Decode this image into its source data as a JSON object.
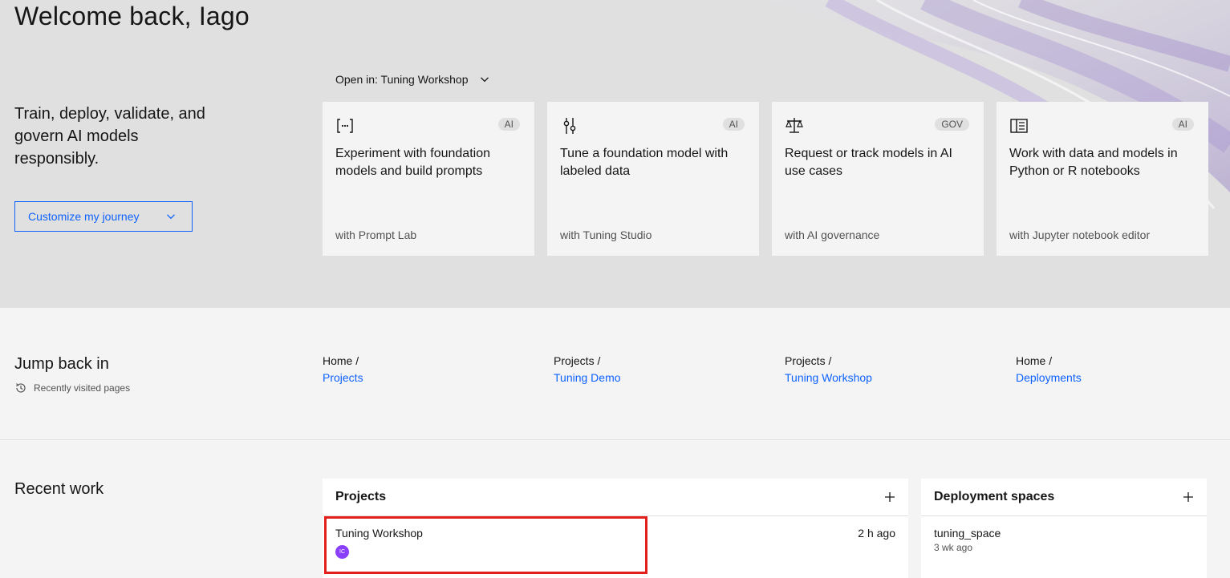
{
  "hero": {
    "welcome": "Welcome back, Iago",
    "tagline": "Train, deploy, validate, and govern AI models responsibly.",
    "customize_label": "Customize my journey",
    "open_in_label": "Open in: Tuning Workshop"
  },
  "cards": [
    {
      "icon": "prompt-brackets-icon",
      "tag": "AI",
      "title": "Experiment with foundation models and build prompts",
      "subtitle": "with Prompt Lab"
    },
    {
      "icon": "tuning-sliders-icon",
      "tag": "AI",
      "title": "Tune a foundation model with labeled data",
      "subtitle": "with Tuning Studio"
    },
    {
      "icon": "scales-icon",
      "tag": "GOV",
      "title": "Request or track models in AI use cases",
      "subtitle": "with AI governance"
    },
    {
      "icon": "notebook-icon",
      "tag": "AI",
      "title": "Work with data and models in Python or R notebooks",
      "subtitle": "with Jupyter notebook editor"
    }
  ],
  "jump": {
    "title": "Jump back in",
    "subtitle": "Recently visited pages",
    "pages": [
      {
        "parent": "Home /",
        "link": "Projects"
      },
      {
        "parent": "Projects /",
        "link": "Tuning Demo"
      },
      {
        "parent": "Projects /",
        "link": "Tuning Workshop"
      },
      {
        "parent": "Home /",
        "link": "Deployments"
      }
    ]
  },
  "recent": {
    "title": "Recent work",
    "projects": {
      "title": "Projects",
      "items": [
        {
          "name": "Tuning Workshop",
          "time": "2 h ago",
          "avatar": "IC"
        }
      ]
    },
    "spaces": {
      "title": "Deployment spaces",
      "items": [
        {
          "name": "tuning_space",
          "time": "3 wk ago"
        }
      ]
    }
  },
  "colors": {
    "accent": "#0f62fe",
    "highlight": "#e3211b",
    "avatar": "#8a3ffc"
  }
}
